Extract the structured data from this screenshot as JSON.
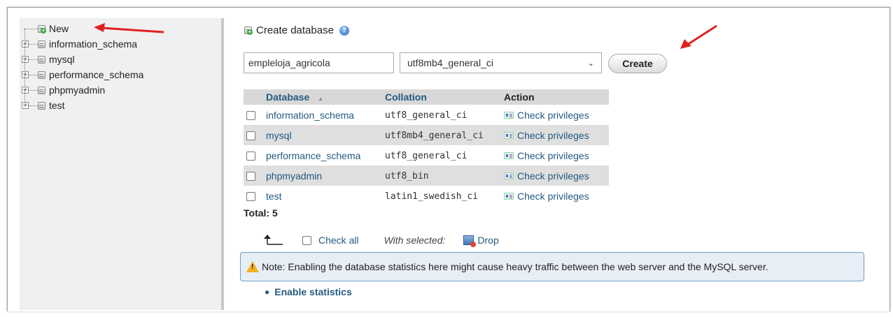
{
  "nav": {
    "items": [
      {
        "label": "New",
        "expandable": false
      },
      {
        "label": "information_schema",
        "expandable": true
      },
      {
        "label": "mysql",
        "expandable": true
      },
      {
        "label": "performance_schema",
        "expandable": true
      },
      {
        "label": "phpmyadmin",
        "expandable": true
      },
      {
        "label": "test",
        "expandable": true
      }
    ]
  },
  "create": {
    "heading": "Create database",
    "db_name_value": "empleloja_agricola",
    "collation_value": "utf8mb4_general_ci",
    "button_label": "Create"
  },
  "table": {
    "headers": {
      "database": "Database",
      "sort_indicator": "▲",
      "collation": "Collation",
      "action": "Action"
    },
    "rows": [
      {
        "name": "information_schema",
        "collation": "utf8_general_ci",
        "action": "Check privileges"
      },
      {
        "name": "mysql",
        "collation": "utf8mb4_general_ci",
        "action": "Check privileges"
      },
      {
        "name": "performance_schema",
        "collation": "utf8_general_ci",
        "action": "Check privileges"
      },
      {
        "name": "phpmyadmin",
        "collation": "utf8_bin",
        "action": "Check privileges"
      },
      {
        "name": "test",
        "collation": "latin1_swedish_ci",
        "action": "Check privileges"
      }
    ],
    "total": "Total: 5"
  },
  "bulk": {
    "check_all": "Check all",
    "with_selected": "With selected:",
    "drop": "Drop"
  },
  "notice": {
    "text": "Note: Enabling the database statistics here might cause heavy traffic between the web server and the MySQL server."
  },
  "stats_link": "Enable statistics",
  "colors": {
    "link": "#235a81",
    "annotation_arrow": "#e02020",
    "notice_border": "#6f9ec9",
    "nav_background": "#f0f0f0"
  }
}
